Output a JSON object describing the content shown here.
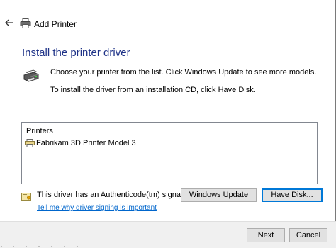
{
  "window": {
    "title": "Add Printer"
  },
  "page": {
    "heading": "Install the printer driver",
    "instruction_1": "Choose your printer from the list. Click Windows Update to see more models.",
    "instruction_2": "To install the driver from an installation CD, click Have Disk."
  },
  "printer_list": {
    "header": "Printers",
    "items": [
      {
        "label": "Fabrikam 3D Printer Model 3",
        "icon": "printer-icon"
      }
    ]
  },
  "signature": {
    "text": "This driver has an Authenticode(tm) signature.",
    "link": "Tell me why driver signing is important",
    "icon": "shield-icon"
  },
  "buttons": {
    "windows_update": "Windows Update",
    "have_disk": "Have Disk...",
    "next": "Next",
    "cancel": "Cancel"
  },
  "icons": {
    "back": "back-arrow-icon",
    "title_printer": "printer-icon",
    "large_printer": "printer-icon"
  },
  "colors": {
    "heading": "#1e3287",
    "link": "#0066cc",
    "button_bg": "#e1e1e1",
    "focus_border": "#0078d7",
    "footer_bg": "#f0f0f0"
  }
}
